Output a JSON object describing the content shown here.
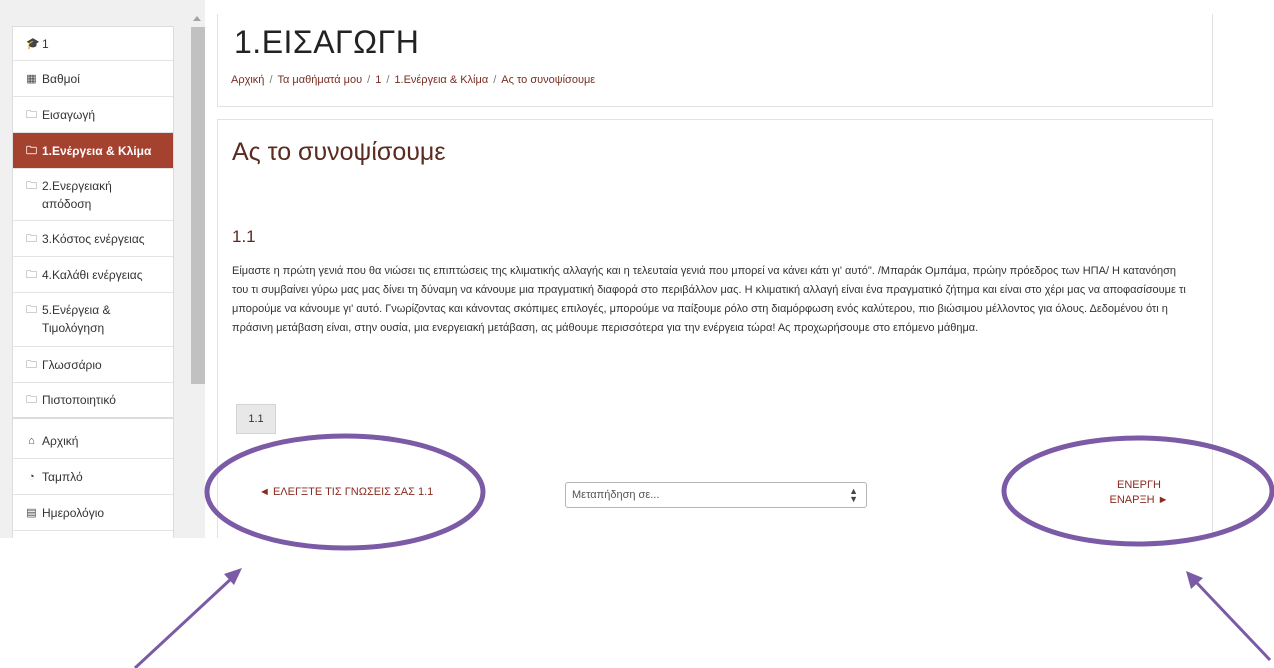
{
  "sidebar": {
    "items": [
      {
        "icon": "graduation-cap-icon",
        "glyph": "🎓",
        "label": "1"
      },
      {
        "icon": "grid-table-icon",
        "glyph": "▦",
        "label": "Βαθμοί"
      },
      {
        "icon": "folder-icon",
        "glyph": "🗀",
        "label": "Εισαγωγή"
      },
      {
        "icon": "folder-icon",
        "glyph": "🗀",
        "label": "1.Ενέργεια & Κλίμα"
      },
      {
        "icon": "folder-icon",
        "glyph": "🗀",
        "label_line1": "2.Ενεργειακή",
        "label_line2": "απόδοση"
      },
      {
        "icon": "folder-icon",
        "glyph": "🗀",
        "label": "3.Κόστος ενέργειας"
      },
      {
        "icon": "folder-icon",
        "glyph": "🗀",
        "label": "4.Καλάθι ενέργειας"
      },
      {
        "icon": "folder-icon",
        "glyph": "🗀",
        "label_line1": "5.Ενέργεια &",
        "label_line2": "Τιμολόγηση"
      },
      {
        "icon": "folder-icon",
        "glyph": "🗀",
        "label": "Γλωσσάριο"
      },
      {
        "icon": "folder-icon",
        "glyph": "🗀",
        "label": "Πιστοποιητικό"
      }
    ],
    "secondary": [
      {
        "icon": "home-icon",
        "glyph": "⌂",
        "label": "Αρχική"
      },
      {
        "icon": "dashboard-icon",
        "glyph": "◔",
        "label": "Ταμπλό"
      },
      {
        "icon": "calendar-icon",
        "glyph": "▤",
        "label": "Ημερολόγιο"
      }
    ]
  },
  "header": {
    "course_title": "1.ΕΙΣΑΓΩΓΗ",
    "breadcrumb": [
      "Αρχική",
      "Τα μαθήματά μου",
      "1",
      "1.Ενέργεια & Κλίμα",
      "Ας το συνοψίσουμε"
    ],
    "breadcrumb_separator": "/"
  },
  "content": {
    "page_title": "Ας το συνοψίσουμε",
    "section_heading": "1.1",
    "body": "Είμαστε η πρώτη γενιά που θα νιώσει τις επιπτώσεις της κλιματικής αλλαγής και η τελευταία γενιά που μπορεί να κάνει κάτι γι' αυτό\". /Μπαράκ Ομπάμα, πρώην πρόεδρος των ΗΠΑ/ Η κατανόηση του τι συμβαίνει γύρω μας μας δίνει τη δύναμη να κάνουμε μια πραγματική διαφορά στο περιβάλλον μας. Η κλιματική αλλαγή είναι ένα πραγματικό ζήτημα και είναι στο χέρι μας να αποφασίσουμε τι μπορούμε να κάνουμε γι' αυτό. Γνωρίζοντας και κάνοντας σκόπιμες επιλογές, μπορούμε να παίξουμε ρόλο στη διαμόρφωση ενός καλύτερου, πιο βιώσιμου μέλλοντος για όλους. Δεδομένου ότι η πράσινη μετάβαση είναι, στην ουσία, μια ενεργειακή μετάβαση, ας μάθουμε περισσότερα για την ενέργεια τώρα! Ας προχωρήσουμε στο επόμενο μάθημα.",
    "page_button": "1.1"
  },
  "navigation": {
    "prev_label": "◄ ΕΛΕΓΞΤΕ ΤΙΣ ΓΝΩΣΕΙΣ ΣΑΣ 1.1",
    "jump_placeholder": "Μεταπήδηση σε...",
    "next_line1": "ΕΝΕΡΓΗ",
    "next_line2": "ΕΝΑΡΞΗ ►"
  },
  "colors": {
    "accent": "#a5412f",
    "link": "#8a2a1f",
    "annotation": "#7b5aa6"
  }
}
